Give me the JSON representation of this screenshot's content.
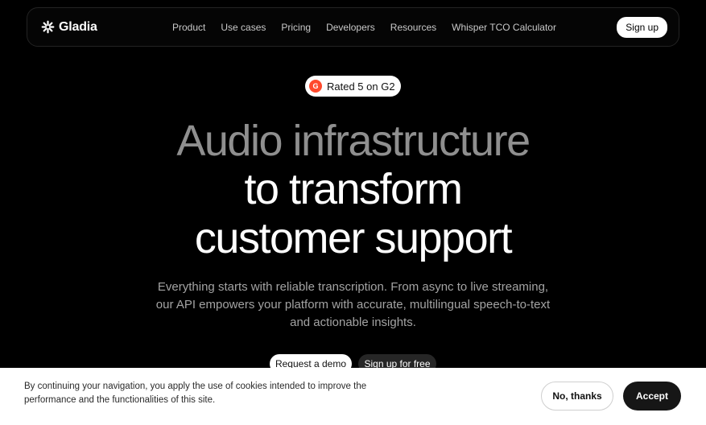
{
  "nav": {
    "logo_text": "Gladia",
    "links": [
      "Product",
      "Use cases",
      "Pricing",
      "Developers",
      "Resources",
      "Whisper TCO Calculator"
    ],
    "signup_label": "Sign up"
  },
  "badge": {
    "icon": "g2-icon",
    "icon_text": "G",
    "label": "Rated 5 on G2"
  },
  "hero": {
    "line1": "Audio infrastructure",
    "line2": "to transform",
    "line3": "customer support",
    "sub_line1": "Everything starts with reliable transcription. From async to live streaming,",
    "sub_line2": "our API empowers your platform with accurate, multilingual speech-to-text",
    "sub_line3": "and actionable insights.",
    "cta_primary": "Request a demo",
    "cta_secondary": "Sign up for free"
  },
  "cookie": {
    "text": "By continuing your navigation, you apply the use of cookies intended to improve the performance and the functionalities of this site.",
    "decline_label": "No, thanks",
    "accept_label": "Accept"
  },
  "colors": {
    "background": "#000000",
    "hero_muted": "#8f8f8f",
    "g2_red": "#ff492c"
  }
}
